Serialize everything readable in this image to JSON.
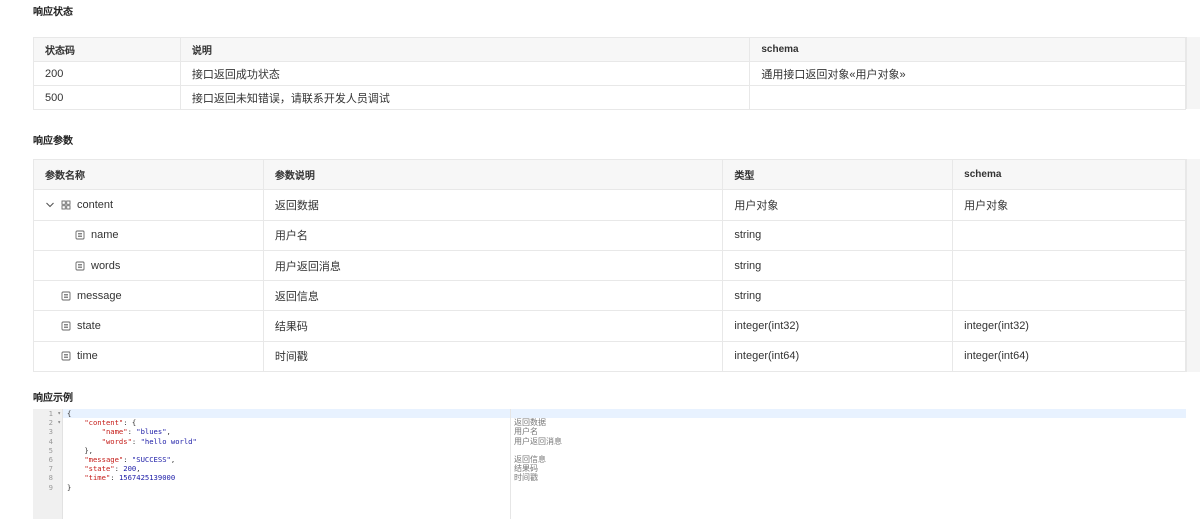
{
  "response_status": {
    "title": "响应状态",
    "headers": [
      "状态码",
      "说明",
      "schema"
    ],
    "rows": [
      [
        "200",
        "接口返回成功状态",
        "通用接口返回对象«用户对象»"
      ],
      [
        "500",
        "接口返回未知错误，请联系开发人员调试",
        ""
      ]
    ]
  },
  "response_params": {
    "title": "响应参数",
    "headers": [
      "参数名称",
      "参数说明",
      "类型",
      "schema"
    ],
    "rows": [
      {
        "name": "content",
        "desc": "返回数据",
        "type": "用户对象",
        "schema": "用户对象"
      },
      {
        "name": "name",
        "desc": "用户名",
        "type": "string",
        "schema": ""
      },
      {
        "name": "words",
        "desc": "用户返回消息",
        "type": "string",
        "schema": ""
      },
      {
        "name": "message",
        "desc": "返回信息",
        "type": "string",
        "schema": ""
      },
      {
        "name": "state",
        "desc": "结果码",
        "type": "integer(int32)",
        "schema": "integer(int32)"
      },
      {
        "name": "time",
        "desc": "时间戳",
        "type": "integer(int64)",
        "schema": "integer(int64)"
      }
    ]
  },
  "response_example": {
    "title": "响应示例",
    "line_numbers": [
      "1",
      "2",
      "3",
      "4",
      "5",
      "6",
      "7",
      "8",
      "9"
    ],
    "code": {
      "l1": "{",
      "l2_key": "\"content\"",
      "l2_rest": ": {",
      "l3_key": "\"name\"",
      "l3_val": "\"blues\"",
      "l4_key": "\"words\"",
      "l4_val": "\"hello world\"",
      "l5": "},",
      "l6_key": "\"message\"",
      "l6_val": "\"SUCCESS\"",
      "l7_key": "\"state\"",
      "l7_val": "200",
      "l8_key": "\"time\"",
      "l8_val": "1567425139000",
      "l9": "}"
    },
    "comments": [
      "返回数据",
      "用户名",
      "用户返回消息",
      "",
      "返回信息",
      "结果码",
      "时间戳"
    ]
  }
}
